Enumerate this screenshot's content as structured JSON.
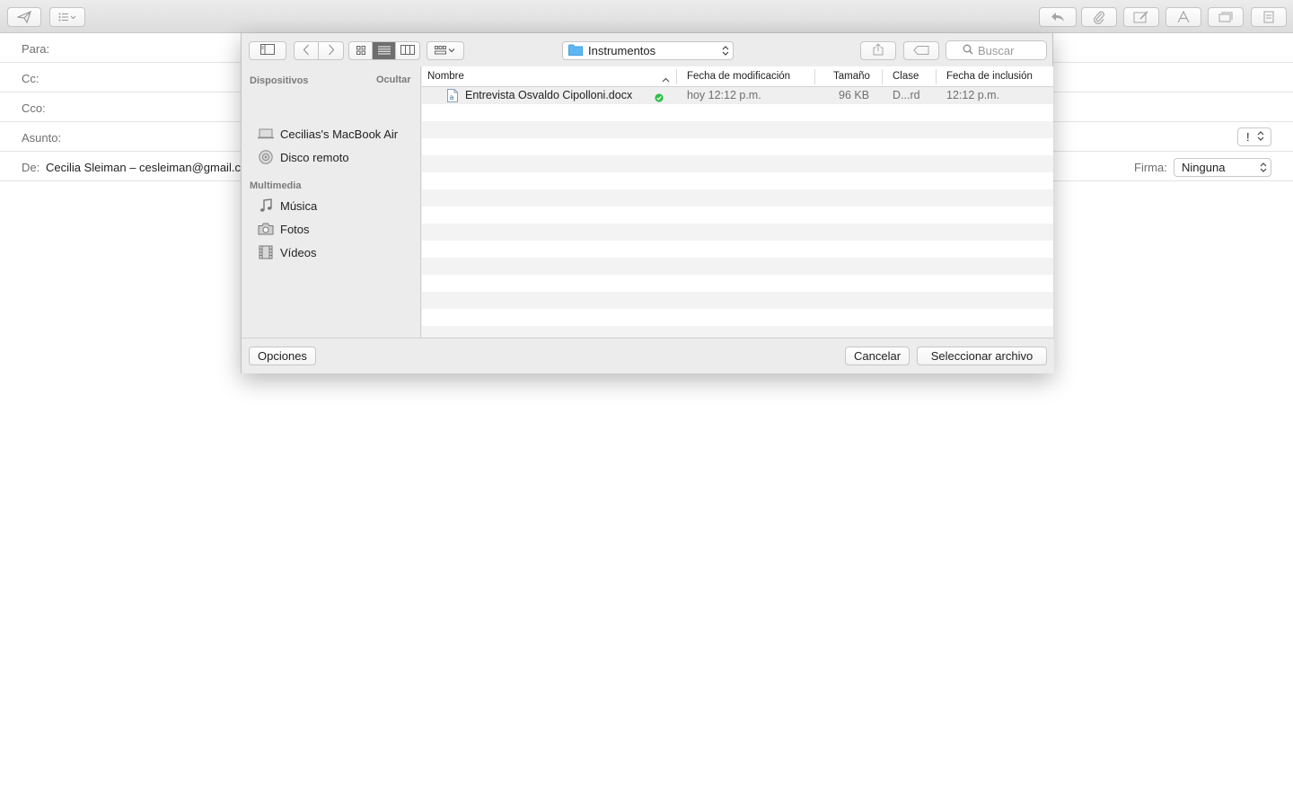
{
  "compose": {
    "header": {
      "to_label": "Para:",
      "cc_label": "Cc:",
      "bcc_label": "Cco:",
      "subject_label": "Asunto:",
      "from_label": "De:",
      "from_value": "Cecilia Sleiman – cesleiman@gmail.com",
      "priority_value": "!",
      "signature_label": "Firma:",
      "signature_value": "Ninguna"
    },
    "toolbar_icons": [
      "send-icon",
      "list-icon",
      "reply-icon",
      "paperclip-icon",
      "markup-icon",
      "font-icon",
      "photo-browser-icon",
      "stationery-icon"
    ]
  },
  "dialog": {
    "location": "Instrumentos",
    "search_placeholder": "Buscar",
    "sidebar": {
      "devices_heading": "Dispositivos",
      "hide_label": "Ocultar",
      "devices": [
        {
          "label": "Cecilias's MacBook Air",
          "icon": "laptop-icon"
        },
        {
          "label": "Disco remoto",
          "icon": "disc-icon"
        }
      ],
      "media_heading": "Multimedia",
      "media": [
        {
          "label": "Música",
          "icon": "music-icon"
        },
        {
          "label": "Fotos",
          "icon": "camera-icon"
        },
        {
          "label": "Vídeos",
          "icon": "film-icon"
        }
      ]
    },
    "columns": {
      "name": "Nombre",
      "modified": "Fecha de modificación",
      "size": "Tamaño",
      "kind": "Clase",
      "added": "Fecha de inclusión"
    },
    "files": [
      {
        "name": "Entrevista Osvaldo Cipolloni.docx",
        "modified": "hoy 12:12 p.m.",
        "size": "96 KB",
        "kind": "D...rd",
        "added": "12:12 p.m.",
        "status": "synced"
      }
    ],
    "buttons": {
      "options": "Opciones",
      "cancel": "Cancelar",
      "select": "Seleccionar archivo"
    }
  }
}
